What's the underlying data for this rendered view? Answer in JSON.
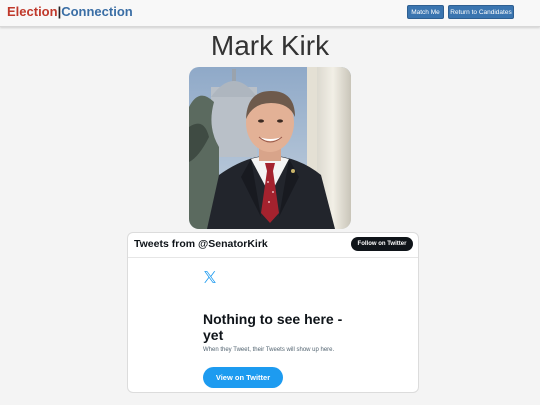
{
  "navbar": {
    "brand_part1": "Election",
    "brand_separator": "|",
    "brand_part2": "Connection",
    "match_label": "Match Me",
    "return_label": "Return to Candidates"
  },
  "candidate": {
    "name": "Mark Kirk"
  },
  "twitter": {
    "header_title": "Tweets from @SenatorKirk",
    "follow_label": "Follow on Twitter",
    "empty_title": "Nothing to see here - yet",
    "empty_subtitle": "When they Tweet, their Tweets will show up here.",
    "view_label": "View on Twitter",
    "logo_icon": "x-logo-icon"
  },
  "colors": {
    "brand_red": "#c0392b",
    "brand_blue": "#3a6ea5",
    "button_blue": "#3a75b0",
    "twitter_blue": "#1d9bf0",
    "twitter_dark": "#0f1419"
  }
}
